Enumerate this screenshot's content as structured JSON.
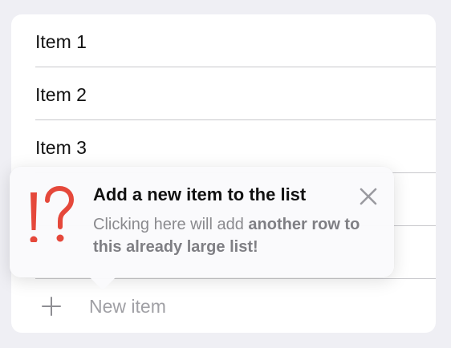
{
  "list": {
    "items": [
      {
        "label": "Item 1"
      },
      {
        "label": "Item 2"
      },
      {
        "label": "Item 3"
      },
      {
        "label": ""
      },
      {
        "label": ""
      }
    ],
    "new_item": {
      "placeholder": "New item",
      "icon": "plus-icon"
    }
  },
  "tip": {
    "icon": "exclamation-question-icon",
    "icon_color": "#e5483b",
    "title": "Add a new item to the list",
    "message_plain": "Clicking here will add ",
    "message_bold": "another row to this already large list!",
    "close_icon": "close-icon"
  },
  "colors": {
    "background": "#efeff4",
    "card": "#ffffff",
    "separator": "#c8c8cc",
    "placeholder": "#a0a0a5",
    "secondary_text": "#8a8a8e"
  }
}
